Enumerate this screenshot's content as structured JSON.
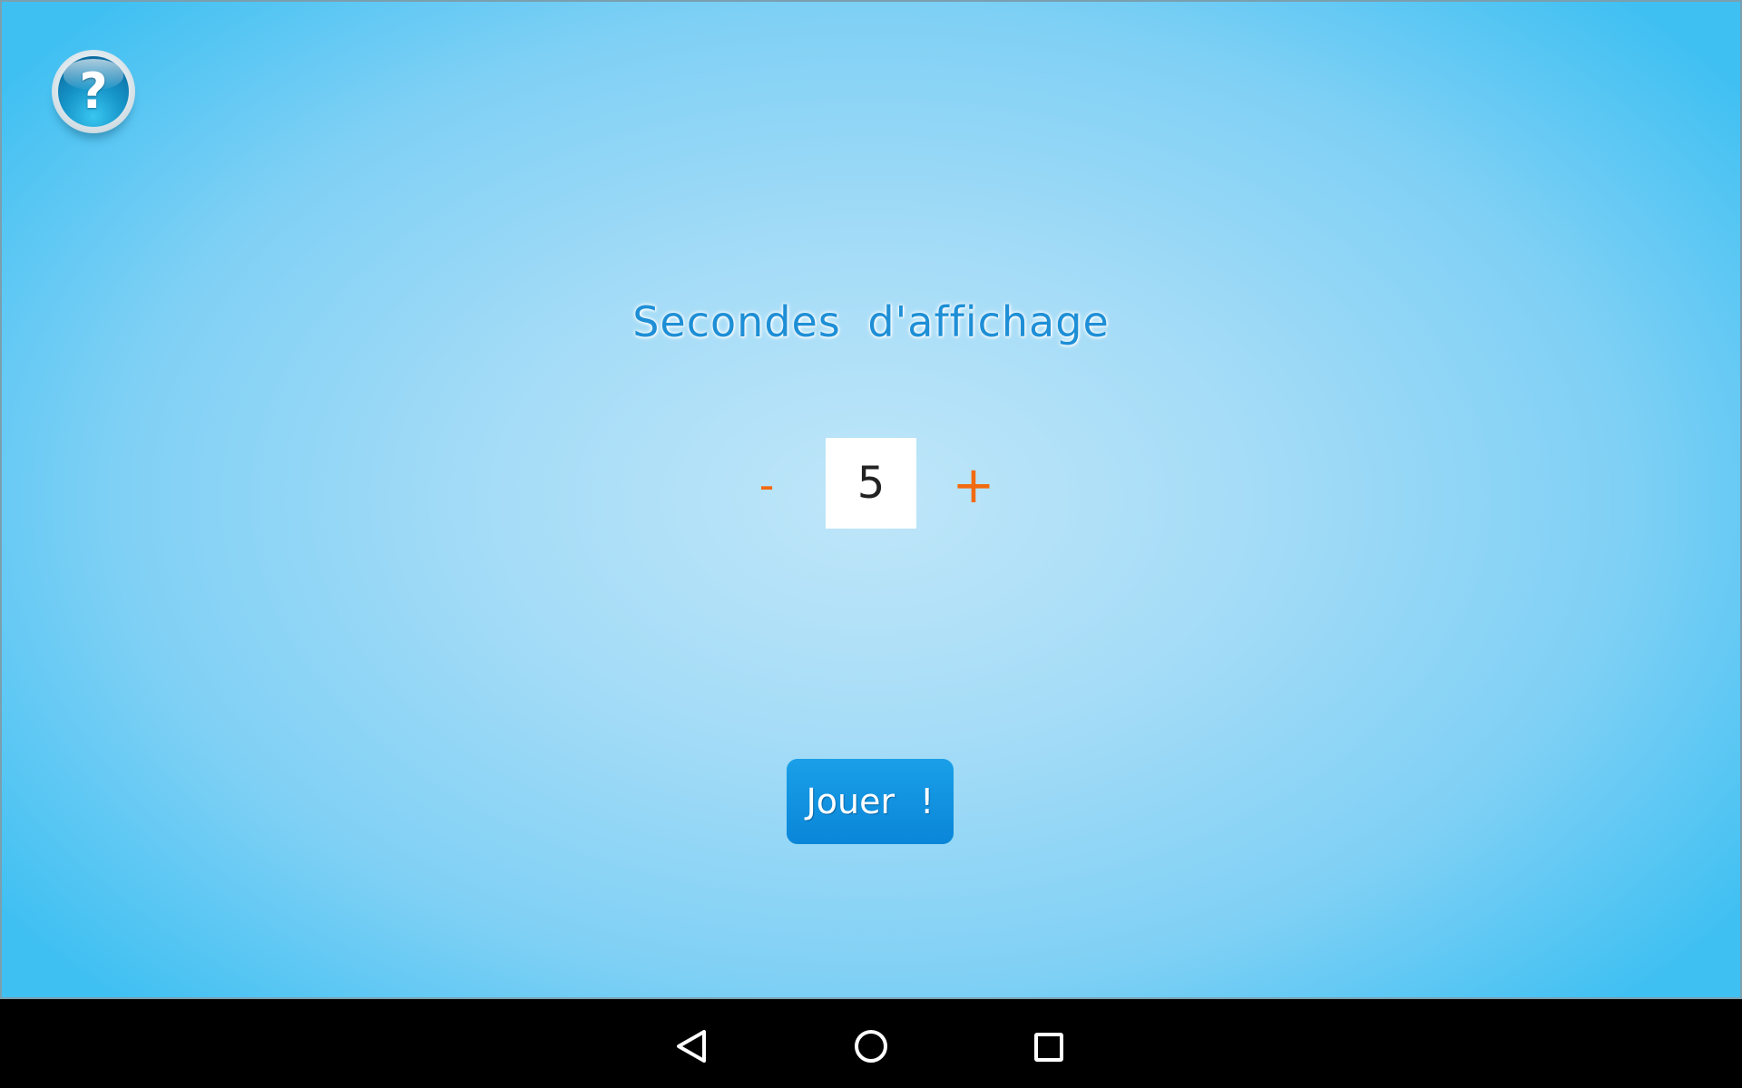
{
  "help": {
    "glyph": "?",
    "icon": "help-question-icon"
  },
  "title": "Secondes d'affichage",
  "stepper": {
    "decrement_label": "-",
    "value": "5",
    "increment_label": "+"
  },
  "play_button": {
    "label": "Jouer !"
  },
  "nav_bar": {
    "icons": [
      "back-triangle-icon",
      "home-circle-icon",
      "recents-square-icon"
    ]
  },
  "colors": {
    "title": "#1e8fd6",
    "stepper_accent": "#f26a10",
    "play_button": "#0a86d8",
    "background_center": "#bfe6f9",
    "background_edge": "#3fc0f2"
  }
}
